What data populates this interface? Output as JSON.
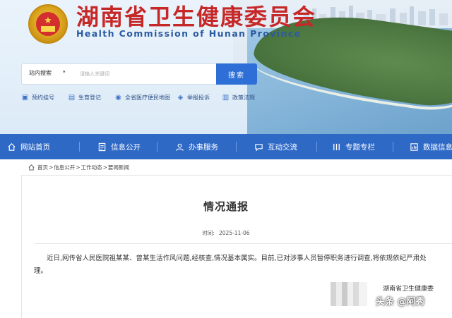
{
  "header": {
    "site_title": "湖南省卫生健康委员会",
    "site_subtitle": "Health Commission of Hunan Province",
    "emblem_icon": "national-emblem",
    "colors": {
      "title_red": "#c62828",
      "subtitle_blue": "#2c5aa0",
      "nav_blue": "#2f69c6",
      "search_blue": "#2d6fd6"
    }
  },
  "search": {
    "scope_label": "站内搜索",
    "placeholder": "请输入关键词",
    "button_label": "搜索"
  },
  "quick_links": [
    {
      "label": "预约挂号",
      "icon": "calendar-icon"
    },
    {
      "label": "生育登记",
      "icon": "clipboard-icon"
    },
    {
      "label": "全省医疗便民地图",
      "icon": "map-icon"
    },
    {
      "label": "举报投诉",
      "icon": "megaphone-icon"
    },
    {
      "label": "政策法规",
      "icon": "book-icon"
    }
  ],
  "nav": [
    {
      "label": "网站首页",
      "icon": "home-icon"
    },
    {
      "label": "信息公开",
      "icon": "document-icon"
    },
    {
      "label": "办事服务",
      "icon": "service-icon"
    },
    {
      "label": "互动交流",
      "icon": "chat-icon"
    },
    {
      "label": "专题专栏",
      "icon": "column-icon"
    },
    {
      "label": "数据信息",
      "icon": "data-icon"
    }
  ],
  "breadcrumb": {
    "icon": "home-icon",
    "items": [
      "首页",
      "信息公开",
      "工作动态",
      "要闻新闻"
    ],
    "separator": ">"
  },
  "article": {
    "title": "情况通报",
    "time_label": "时间:",
    "time_value": "2025-11-06",
    "body": "近日,网传省人民医院祖某某、曾某生活作风问题,经核查,情况基本属实。目前,已对涉事人员暂停职务进行调查,将依规依纪严肃处理。",
    "signature": "湖南省卫生健康委"
  },
  "watermark": "头条 @阿秀"
}
